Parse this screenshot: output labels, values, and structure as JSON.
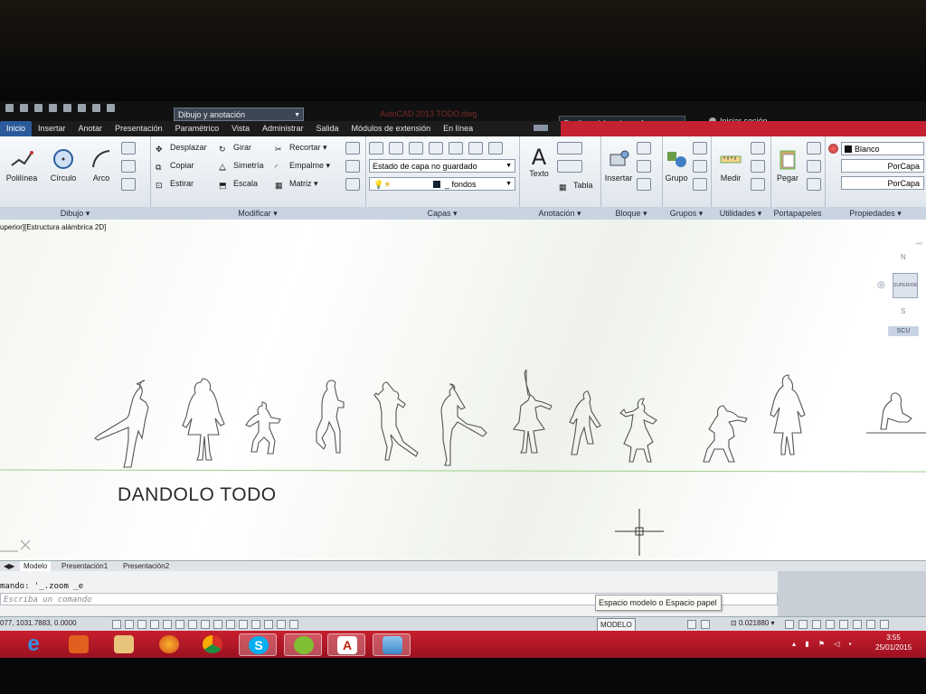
{
  "titlebar": {
    "workspace": "Dibujo y anotación",
    "app_title": "AutoCAD 2013   TODO.dwg",
    "search_placeholder": "Escriba palabra clave o frase",
    "signin": "Iniciar sesión"
  },
  "tabs": [
    {
      "label": "Inicio"
    },
    {
      "label": "Insertar"
    },
    {
      "label": "Anotar"
    },
    {
      "label": "Presentación"
    },
    {
      "label": "Paramétrico"
    },
    {
      "label": "Vista"
    },
    {
      "label": "Administrar"
    },
    {
      "label": "Salida"
    },
    {
      "label": "Módulos de extensión"
    },
    {
      "label": "En línea"
    }
  ],
  "ribbon": {
    "dibujo": {
      "polilinea": "Polilínea",
      "circulo": "Círculo",
      "arco": "Arco",
      "label": "Dibujo"
    },
    "modificar": {
      "desplazar": "Desplazar",
      "girar": "Girar",
      "recortar": "Recortar",
      "copiar": "Copiar",
      "simetria": "Simetría",
      "empalme": "Empalme",
      "estirar": "Estirar",
      "escala": "Escala",
      "matriz": "Matriz",
      "label": "Modificar"
    },
    "capas": {
      "estado": "Estado de capa no guardado",
      "layer": "_ fondos",
      "label": "Capas"
    },
    "anotacion": {
      "texto": "Texto",
      "tabla": "Tabla",
      "label": "Anotación"
    },
    "bloque": {
      "insertar": "Insertar",
      "label": "Bloque"
    },
    "grupos": {
      "grupo": "Grupo",
      "label": "Grupos"
    },
    "utilidades": {
      "medir": "Medir",
      "label": "Utilidades"
    },
    "portapapeles": {
      "pegar": "Pegar",
      "label": "Portapapeles"
    },
    "propiedades": {
      "color": "Blanco",
      "linetype": "PorCapa",
      "lineweight": "PorCapa",
      "label": "Propiedades"
    }
  },
  "viewport": {
    "label": "uperior][Estructura alámbrica 2D]",
    "compass": {
      "n": "N",
      "s": "S",
      "center": "SUPERIOR",
      "wcs": "SCU"
    },
    "drawing_text": "DANDOLO TODO"
  },
  "layout_tabs": [
    {
      "label": "Modelo"
    },
    {
      "label": "Presentación1"
    },
    {
      "label": "Presentación2"
    }
  ],
  "command": {
    "history": "mando:  '_.zoom _e",
    "placeholder": "Escriba un comando",
    "tooltip": "Espacio modelo o Espacio papel"
  },
  "status": {
    "coords": "077, 1031.7883, 0.0000",
    "modelo": "MODELO",
    "scale": "0.021880"
  },
  "taskbar": {
    "time": "3:55",
    "date": "25/01/2015",
    "apps": [
      {
        "icon": "internet-explorer-icon"
      },
      {
        "icon": "media-player-icon"
      },
      {
        "icon": "file-explorer-icon"
      },
      {
        "icon": "firefox-icon"
      },
      {
        "icon": "chrome-icon"
      },
      {
        "icon": "skype-icon"
      },
      {
        "icon": "spotify-icon"
      },
      {
        "icon": "autocad-icon"
      },
      {
        "icon": "photo-viewer-icon"
      }
    ]
  },
  "colors": {
    "taskbar": "#c42231",
    "active_tab": "#2a5a9a",
    "ribbon_bg": "#e9eef4"
  }
}
